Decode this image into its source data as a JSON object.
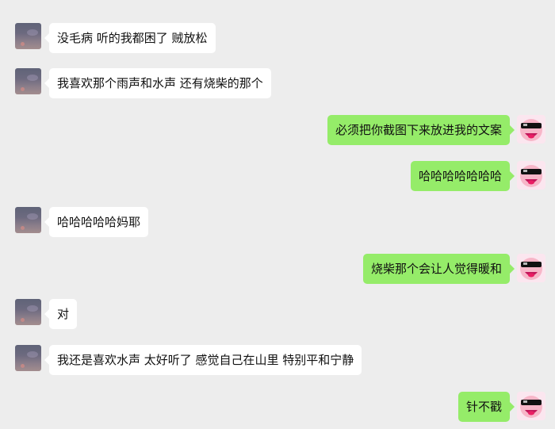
{
  "colors": {
    "background": "#ededed",
    "incoming_bubble": "#ffffff",
    "outgoing_bubble": "#95ec69"
  },
  "messages": [
    {
      "side": "left",
      "text": "没毛病 听的我都困了 贼放松"
    },
    {
      "side": "left",
      "text": "我喜欢那个雨声和水声 还有烧柴的那个"
    },
    {
      "side": "right",
      "text": "必须把你截图下来放进我的文案"
    },
    {
      "side": "right",
      "text": "哈哈哈哈哈哈哈"
    },
    {
      "side": "left",
      "text": "哈哈哈哈哈妈耶"
    },
    {
      "side": "right",
      "text": "烧柴那个会让人觉得暖和"
    },
    {
      "side": "left",
      "text": "对"
    },
    {
      "side": "left",
      "text": "我还是喜欢水声  太好听了 感觉自己在山里 特别平和宁静"
    },
    {
      "side": "right",
      "text": "针不戳"
    }
  ]
}
